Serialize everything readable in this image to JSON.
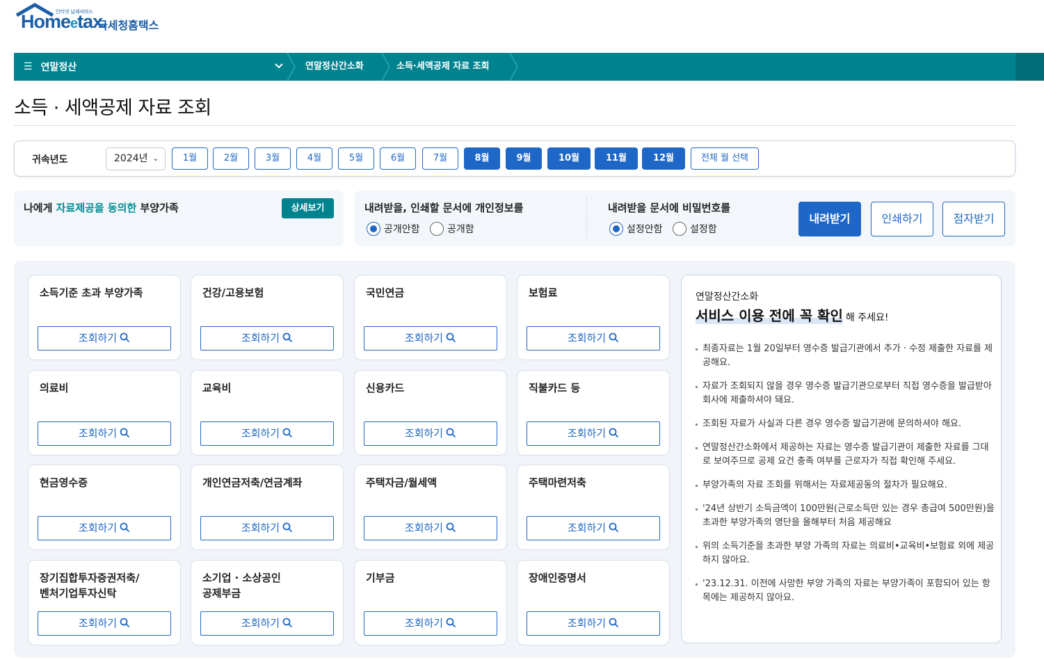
{
  "logo": {
    "brand_small": "인터넷 납세서비스",
    "brand": "Home",
    "brand_e": "e",
    "brand_tail": "tax.",
    "name_kr": "국세청홈택스"
  },
  "nav": {
    "menu_label": "연말정산",
    "crumbs": [
      "연말정산간소화",
      "소득·세액공제 자료 조회"
    ]
  },
  "page_title": "소득 · 세액공제 자료 조회",
  "filter": {
    "label": "귀속년도",
    "year": "2024년",
    "months": [
      {
        "label": "1월",
        "active": false
      },
      {
        "label": "2월",
        "active": false
      },
      {
        "label": "3월",
        "active": false
      },
      {
        "label": "4월",
        "active": false
      },
      {
        "label": "5월",
        "active": false
      },
      {
        "label": "6월",
        "active": false
      },
      {
        "label": "7월",
        "active": false
      },
      {
        "label": "8월",
        "active": true
      },
      {
        "label": "9월",
        "active": true
      },
      {
        "label": "10월",
        "active": true
      },
      {
        "label": "11월",
        "active": true
      },
      {
        "label": "12월",
        "active": true
      }
    ],
    "all_months": "전체 월 선택"
  },
  "consent": {
    "prefix": "나에게 ",
    "highlight": "자료제공을 동의한",
    "suffix": " 부양가족",
    "detail_button": "상세보기"
  },
  "privacy": {
    "title": "내려받을, 인쇄할 문서에 개인정보를",
    "options": [
      "공개안함",
      "공개함"
    ],
    "selected": "공개안함"
  },
  "password": {
    "title": "내려받을 문서에 비밀번호를",
    "options": [
      "설정안함",
      "설정함"
    ],
    "selected": "설정안함"
  },
  "actions": {
    "download": "내려받기",
    "print": "인쇄하기",
    "braille": "점자받기"
  },
  "query_label": "조회하기",
  "cards": [
    {
      "title": "소득기준 초과 부양가족"
    },
    {
      "title": "건강/고용보험"
    },
    {
      "title": "국민연금"
    },
    {
      "title": "보험료"
    },
    {
      "title": "의료비"
    },
    {
      "title": "교육비"
    },
    {
      "title": "신용카드"
    },
    {
      "title": "직불카드 등"
    },
    {
      "title": "현금영수증"
    },
    {
      "title": "개인연금저축/연금계좌"
    },
    {
      "title": "주택자금/월세액"
    },
    {
      "title": "주택마련저축"
    },
    {
      "title": "장기집합투자증권저축/\n벤처기업투자신탁"
    },
    {
      "title": "소기업 · 소상공인\n공제부금"
    },
    {
      "title": "기부금"
    },
    {
      "title": "장애인증명서"
    }
  ],
  "notice": {
    "subtitle": "연말정산간소화",
    "title_mark": "서비스 이용 전에 꼭 확인",
    "title_tail": "해 주세요!",
    "items": [
      "최종자료는 1월 20일부터 영수증 발급기관에서 추가 · 수정 제출한 자료를 제공해요.",
      "자료가 조회되지 않을 경우 영수증 발급기관으로부터 직접 영수증을 발급받아 회사에 제출하셔야 돼요.",
      "조회된 자료가 사실과 다른 경우 영수증 발급기관에 문의하셔야 해요.",
      "연말정산간소화에서 제공하는 자료는 영수증 발급기관이 제출한 자료를 그대로 보여주므로 공제 요건 충족 여부를 근로자가 직접 확인해 주세요.",
      "부양가족의 자료 조회를 위해서는 자료제공동의 절차가 필요해요.",
      "'24년 상반기 소득금액이 100만원(근로소득만 있는 경우 총급여 500만원)을 초과한 부양가족의 명단을 올해부터 처음 제공해요",
      "위의 소득기준을 초과한 부양 가족의 자료는 의료비•교육비•보험료 외에 제공하지 않아요.",
      "'23.12.31. 이전에 사망한 부양 가족의 자료는 부양가족이 포함되어 있는 항목에는 제공하지 않아요."
    ]
  },
  "colors": {
    "teal": "#00838f",
    "blue": "#1f67c6",
    "panel_bg": "#f3f6fa"
  }
}
